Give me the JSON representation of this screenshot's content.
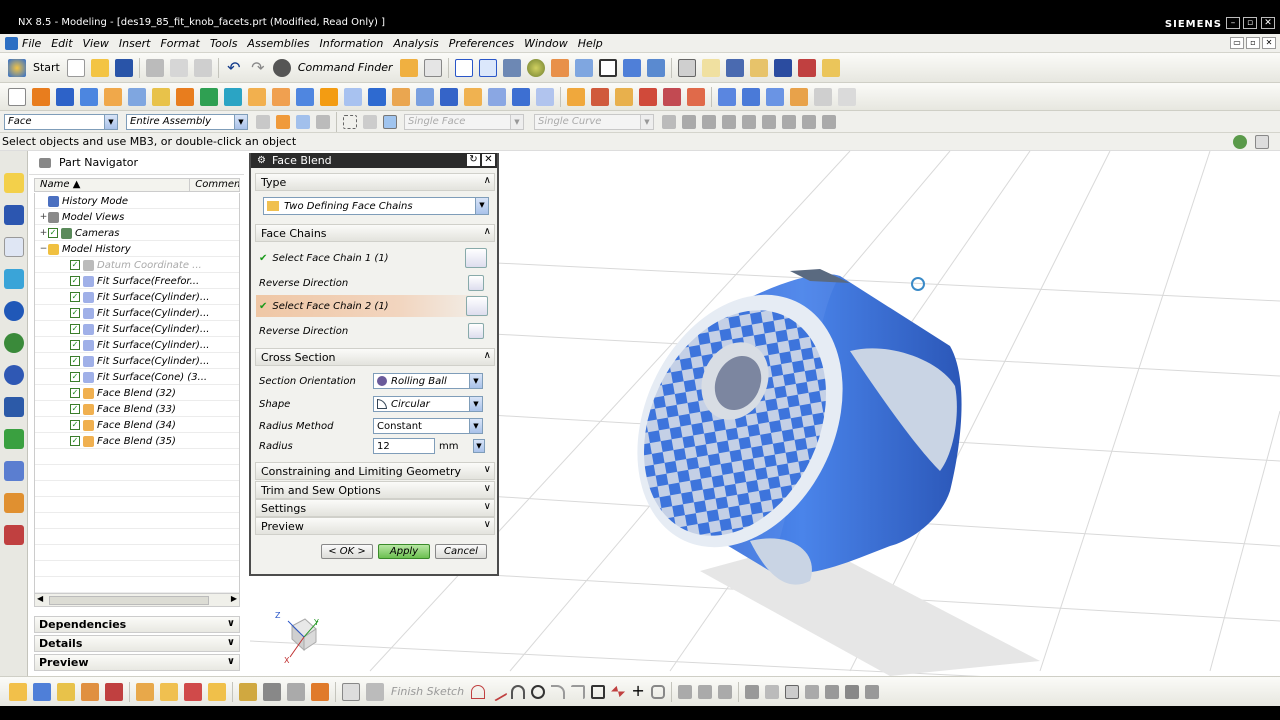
{
  "window": {
    "title": "NX 8.5 - Modeling - [des19_85_fit_knob_facets.prt (Modified, Read Only) ]",
    "brand": "SIEMENS"
  },
  "menu": [
    "File",
    "Edit",
    "View",
    "Insert",
    "Format",
    "Tools",
    "Assemblies",
    "Information",
    "Analysis",
    "Preferences",
    "Window",
    "Help"
  ],
  "toolbar": {
    "start_label": "Start",
    "command_finder_label": "Command Finder"
  },
  "selection": {
    "type_filter": "Face",
    "scope": "Entire Assembly",
    "face_rule": "Single Face",
    "curve_rule": "Single Curve"
  },
  "status": "Select objects and use MB3, or double-click an object",
  "navigator": {
    "title": "Part Navigator",
    "col_name": "Name",
    "col_comment": "Commen",
    "items": [
      {
        "label": "History Mode",
        "level": 1,
        "checked": false,
        "expand": "",
        "dim": false,
        "icon": "clock-icon"
      },
      {
        "label": "Model Views",
        "level": 1,
        "checked": false,
        "expand": "+",
        "dim": false,
        "icon": "views-icon"
      },
      {
        "label": "Cameras",
        "level": 1,
        "checked": true,
        "expand": "+",
        "dim": false,
        "icon": "camera-icon"
      },
      {
        "label": "Model History",
        "level": 1,
        "checked": false,
        "expand": "−",
        "dim": false,
        "icon": "folder-icon"
      },
      {
        "label": "Datum Coordinate ...",
        "level": 2,
        "checked": true,
        "expand": "",
        "dim": true,
        "icon": "datum-icon"
      },
      {
        "label": "Fit Surface(Freefor...",
        "level": 2,
        "checked": true,
        "expand": "",
        "dim": false,
        "icon": "surface-icon"
      },
      {
        "label": "Fit Surface(Cylinder)...",
        "level": 2,
        "checked": true,
        "expand": "",
        "dim": false,
        "icon": "surface-icon"
      },
      {
        "label": "Fit Surface(Cylinder)...",
        "level": 2,
        "checked": true,
        "expand": "",
        "dim": false,
        "icon": "surface-icon"
      },
      {
        "label": "Fit Surface(Cylinder)...",
        "level": 2,
        "checked": true,
        "expand": "",
        "dim": false,
        "icon": "surface-icon"
      },
      {
        "label": "Fit Surface(Cylinder)...",
        "level": 2,
        "checked": true,
        "expand": "",
        "dim": false,
        "icon": "surface-icon"
      },
      {
        "label": "Fit Surface(Cylinder)...",
        "level": 2,
        "checked": true,
        "expand": "",
        "dim": false,
        "icon": "surface-icon"
      },
      {
        "label": "Fit Surface(Cone) (3...",
        "level": 2,
        "checked": true,
        "expand": "",
        "dim": false,
        "icon": "surface-icon"
      },
      {
        "label": "Face Blend (32)",
        "level": 2,
        "checked": true,
        "expand": "",
        "dim": false,
        "icon": "blend-icon"
      },
      {
        "label": "Face Blend (33)",
        "level": 2,
        "checked": true,
        "expand": "",
        "dim": false,
        "icon": "blend-icon"
      },
      {
        "label": "Face Blend (34)",
        "level": 2,
        "checked": true,
        "expand": "",
        "dim": false,
        "icon": "blend-icon"
      },
      {
        "label": "Face Blend (35)",
        "level": 2,
        "checked": true,
        "expand": "",
        "dim": false,
        "icon": "blend-icon"
      }
    ],
    "panels": [
      "Dependencies",
      "Details",
      "Preview"
    ]
  },
  "dialog": {
    "title": "Face Blend",
    "type_section": "Type",
    "type_value": "Two Defining Face Chains",
    "face_chains_section": "Face Chains",
    "select_chain1": "Select Face Chain 1 (1)",
    "reverse1": "Reverse Direction",
    "select_chain2": "Select Face Chain 2 (1)",
    "reverse2": "Reverse Direction",
    "cross_section": "Cross Section",
    "section_orientation_label": "Section Orientation",
    "section_orientation_value": "Rolling Ball",
    "shape_label": "Shape",
    "shape_value": "Circular",
    "radius_method_label": "Radius Method",
    "radius_method_value": "Constant",
    "radius_label": "Radius",
    "radius_value": "12",
    "radius_unit": "mm",
    "collapsed_sections": [
      "Constraining and Limiting Geometry",
      "Trim and Sew Options",
      "Settings",
      "Preview"
    ],
    "ok": "< OK >",
    "apply": "Apply",
    "cancel": "Cancel"
  },
  "sketch": {
    "finish_label": "Finish Sketch"
  },
  "triad": {
    "x": "X",
    "y": "Y",
    "z": "Z"
  },
  "colors": {
    "accent": "#3a6fd8",
    "highlight_row": "#f0c8a0",
    "model_blue": "#3f78e0"
  }
}
